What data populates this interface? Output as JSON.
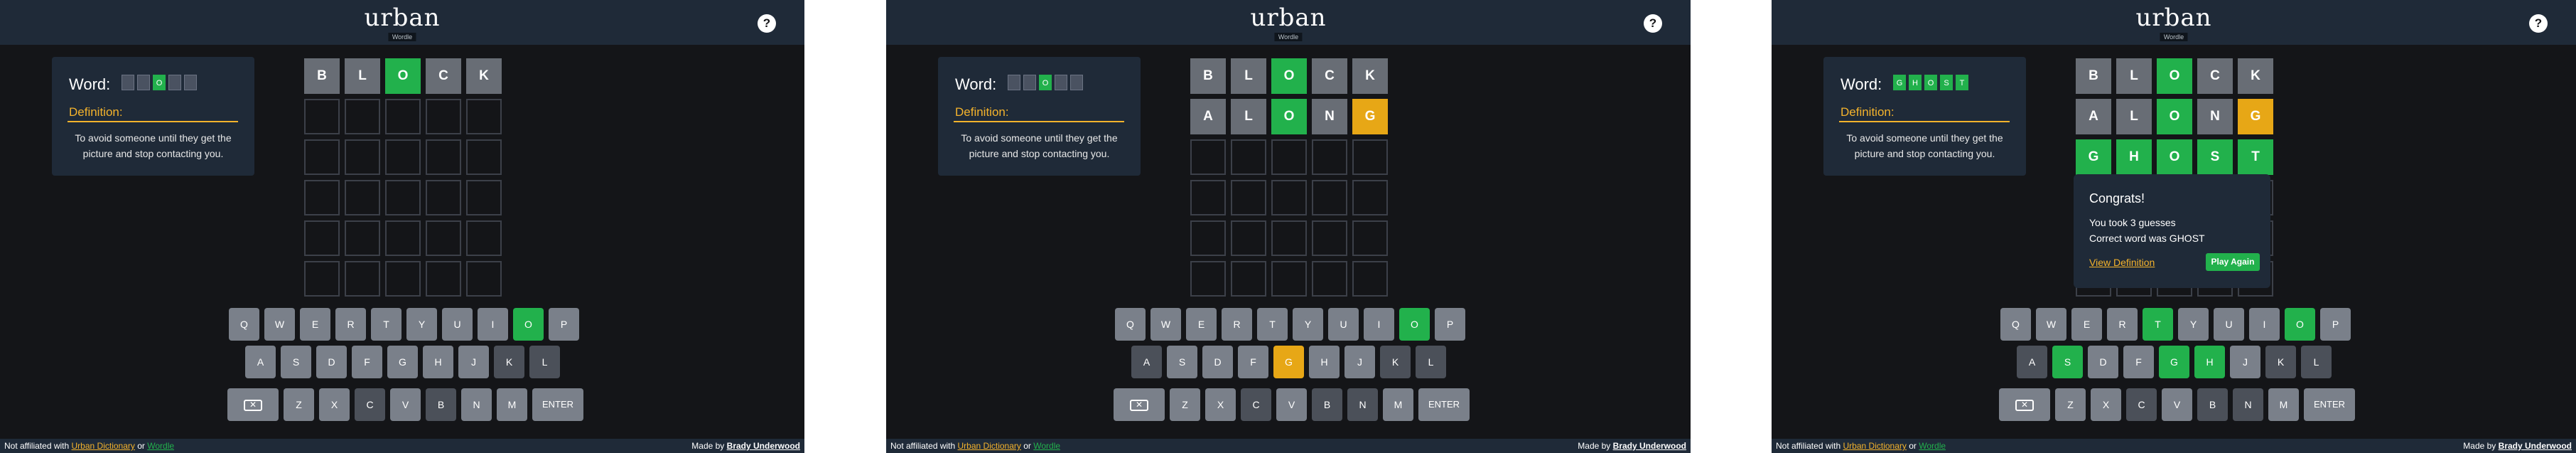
{
  "app": {
    "logo_main": "urban",
    "logo_sub": "Wordle",
    "help_label": "?",
    "word_label": "Word:",
    "definition_label": "Definition:",
    "definition_text": "To avoid someone until they get the picture and stop contacting you."
  },
  "footer": {
    "not_affiliated": "Not affiliated with",
    "urban_dictionary": "Urban Dictionary",
    "or": "or",
    "wordle": "Wordle",
    "made_by": "Made by",
    "author": "Brady Underwood"
  },
  "colors": {
    "correct": "#22b14c",
    "present": "#e7a716",
    "absent": "#4b5059",
    "filled": "#686d75",
    "background": "#141518",
    "card": "#1f2a38"
  },
  "keyboard_layout": [
    [
      "Q",
      "W",
      "E",
      "R",
      "T",
      "Y",
      "U",
      "I",
      "O",
      "P"
    ],
    [
      "A",
      "S",
      "D",
      "F",
      "G",
      "H",
      "J",
      "K",
      "L"
    ],
    [
      "BACKSPACE",
      "Z",
      "X",
      "C",
      "V",
      "B",
      "N",
      "M",
      "ENTER"
    ]
  ],
  "backspace_icon": "backspace-icon",
  "screens": [
    {
      "word_reveal": [
        "",
        "",
        "O",
        "",
        ""
      ],
      "word_states": [
        "",
        "",
        "g",
        "",
        ""
      ],
      "board": [
        [
          [
            "B",
            "f"
          ],
          [
            "L",
            "f"
          ],
          [
            "O",
            "g"
          ],
          [
            "C",
            "f"
          ],
          [
            "K",
            "f"
          ]
        ],
        [
          [
            "",
            ""
          ],
          [
            "",
            ""
          ],
          [
            "",
            ""
          ],
          [
            "",
            ""
          ],
          [
            "",
            ""
          ]
        ],
        [
          [
            "",
            ""
          ],
          [
            "",
            ""
          ],
          [
            "",
            ""
          ],
          [
            "",
            ""
          ],
          [
            "",
            ""
          ]
        ],
        [
          [
            "",
            ""
          ],
          [
            "",
            ""
          ],
          [
            "",
            ""
          ],
          [
            "",
            ""
          ],
          [
            "",
            ""
          ]
        ],
        [
          [
            "",
            ""
          ],
          [
            "",
            ""
          ],
          [
            "",
            ""
          ],
          [
            "",
            ""
          ],
          [
            "",
            ""
          ]
        ],
        [
          [
            "",
            ""
          ],
          [
            "",
            ""
          ],
          [
            "",
            ""
          ],
          [
            "",
            ""
          ],
          [
            "",
            ""
          ]
        ]
      ],
      "key_states": {
        "B": "d",
        "L": "d",
        "C": "d",
        "K": "d",
        "O": "g"
      }
    },
    {
      "word_reveal": [
        "",
        "",
        "O",
        "",
        ""
      ],
      "word_states": [
        "",
        "",
        "g",
        "",
        ""
      ],
      "board": [
        [
          [
            "B",
            "f"
          ],
          [
            "L",
            "f"
          ],
          [
            "O",
            "g"
          ],
          [
            "C",
            "f"
          ],
          [
            "K",
            "f"
          ]
        ],
        [
          [
            "A",
            "f"
          ],
          [
            "L",
            "f"
          ],
          [
            "O",
            "g"
          ],
          [
            "N",
            "f"
          ],
          [
            "G",
            "y"
          ]
        ],
        [
          [
            "",
            ""
          ],
          [
            "",
            ""
          ],
          [
            "",
            ""
          ],
          [
            "",
            ""
          ],
          [
            "",
            ""
          ]
        ],
        [
          [
            "",
            ""
          ],
          [
            "",
            ""
          ],
          [
            "",
            ""
          ],
          [
            "",
            ""
          ],
          [
            "",
            ""
          ]
        ],
        [
          [
            "",
            ""
          ],
          [
            "",
            ""
          ],
          [
            "",
            ""
          ],
          [
            "",
            ""
          ],
          [
            "",
            ""
          ]
        ],
        [
          [
            "",
            ""
          ],
          [
            "",
            ""
          ],
          [
            "",
            ""
          ],
          [
            "",
            ""
          ],
          [
            "",
            ""
          ]
        ]
      ],
      "key_states": {
        "B": "d",
        "L": "d",
        "C": "d",
        "K": "d",
        "A": "d",
        "N": "d",
        "O": "g",
        "G": "y"
      }
    },
    {
      "word_reveal": [
        "G",
        "H",
        "O",
        "S",
        "T"
      ],
      "word_states": [
        "g",
        "g",
        "g",
        "g",
        "g"
      ],
      "board": [
        [
          [
            "B",
            "f"
          ],
          [
            "L",
            "f"
          ],
          [
            "O",
            "g"
          ],
          [
            "C",
            "f"
          ],
          [
            "K",
            "f"
          ]
        ],
        [
          [
            "A",
            "f"
          ],
          [
            "L",
            "f"
          ],
          [
            "O",
            "g"
          ],
          [
            "N",
            "f"
          ],
          [
            "G",
            "y"
          ]
        ],
        [
          [
            "G",
            "g"
          ],
          [
            "H",
            "g"
          ],
          [
            "O",
            "g"
          ],
          [
            "S",
            "g"
          ],
          [
            "T",
            "g"
          ]
        ],
        [
          [
            "",
            ""
          ],
          [
            "",
            ""
          ],
          [
            "",
            ""
          ],
          [
            "",
            ""
          ],
          [
            "",
            ""
          ]
        ],
        [
          [
            "",
            ""
          ],
          [
            "",
            ""
          ],
          [
            "",
            ""
          ],
          [
            "",
            ""
          ],
          [
            "",
            ""
          ]
        ],
        [
          [
            "",
            ""
          ],
          [
            "",
            ""
          ],
          [
            "",
            ""
          ],
          [
            "",
            ""
          ],
          [
            "",
            ""
          ]
        ]
      ],
      "key_states": {
        "B": "d",
        "L": "d",
        "C": "d",
        "K": "d",
        "A": "d",
        "N": "d",
        "O": "g",
        "G": "g",
        "H": "g",
        "S": "g",
        "T": "g"
      },
      "congrats": {
        "title": "Congrats!",
        "line1": "You took 3 guesses",
        "line2": "Correct word was GHOST",
        "link": "View Definition",
        "button": "Play Again"
      }
    }
  ]
}
